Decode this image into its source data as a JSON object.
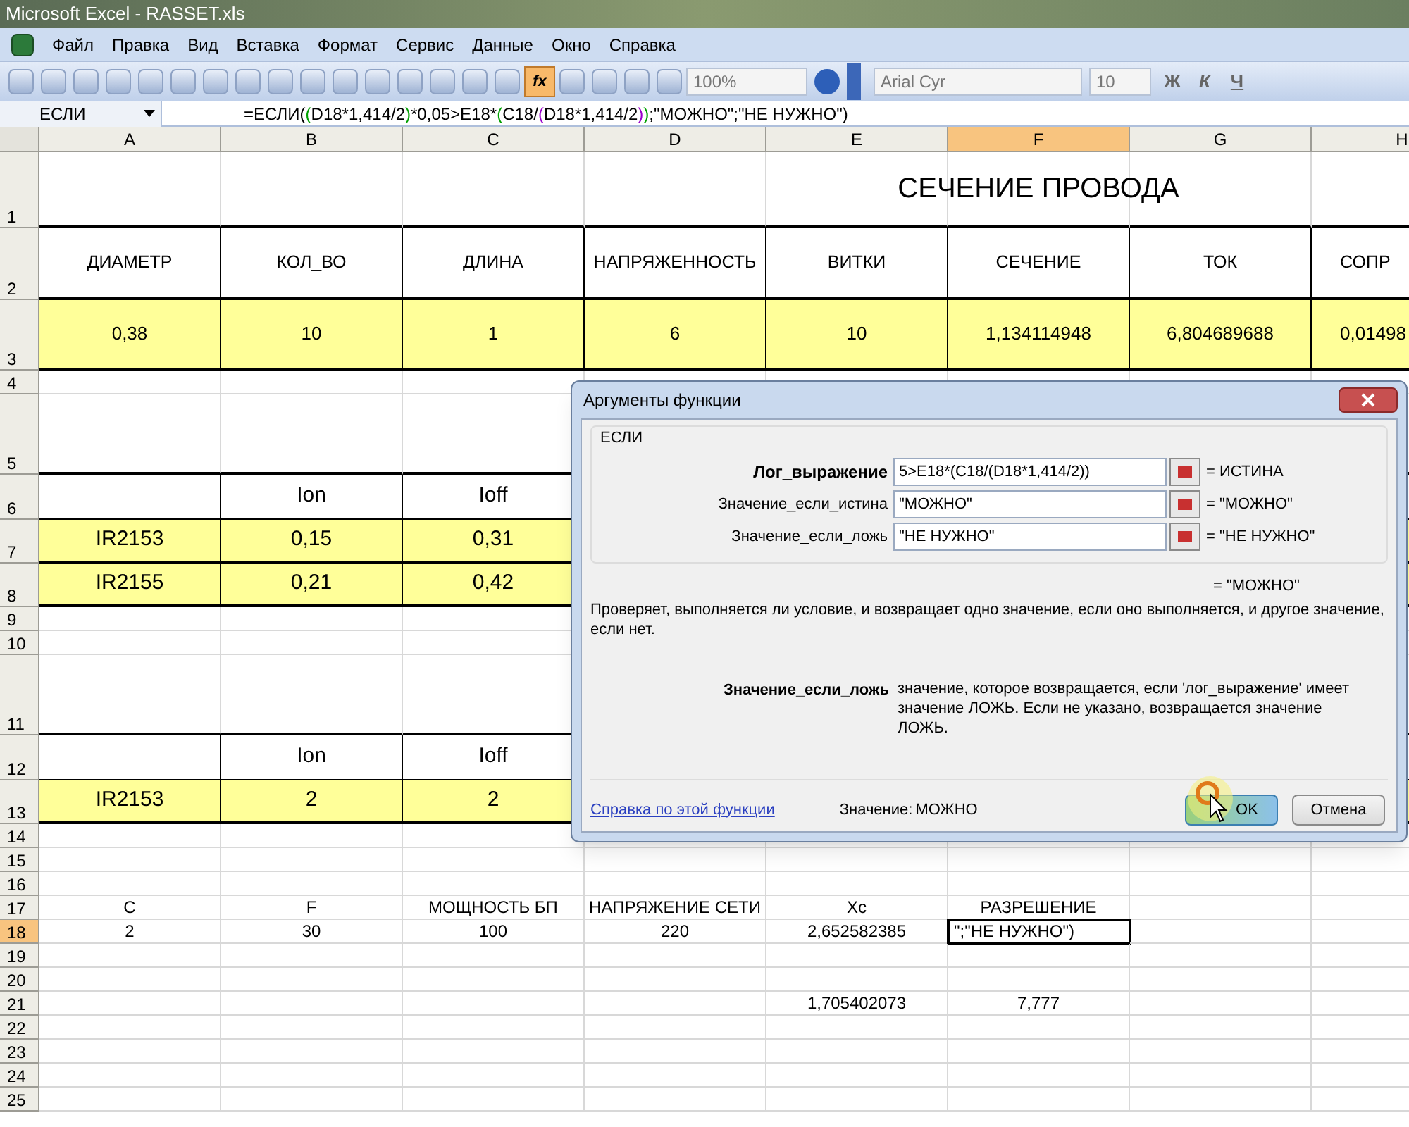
{
  "window": {
    "title": "Microsoft Excel - RASSET.xls"
  },
  "menu": [
    {
      "label": "Файл"
    },
    {
      "label": "Правка"
    },
    {
      "label": "Вид"
    },
    {
      "label": "Вставка"
    },
    {
      "label": "Формат"
    },
    {
      "label": "Сервис"
    },
    {
      "label": "Данные"
    },
    {
      "label": "Окно"
    },
    {
      "label": "Справка"
    }
  ],
  "toolbar": {
    "insert_function_on": true,
    "insert_function_label": "fx",
    "zoom": "100%",
    "font": "Arial Cyr",
    "size": "10",
    "format_buttons": [
      "Ж",
      "К",
      "Ч"
    ]
  },
  "formula_bar": {
    "name_box": "ЕСЛИ",
    "segments": [
      {
        "text": "=ЕСЛИ(",
        "color": "#000000"
      },
      {
        "text": "(",
        "color": "#00a000"
      },
      {
        "text": "D18*1,414/2",
        "color": "#000000"
      },
      {
        "text": ")",
        "color": "#00a000"
      },
      {
        "text": "*0,05>E18*",
        "color": "#000000"
      },
      {
        "text": "(",
        "color": "#00a000"
      },
      {
        "text": "C18/",
        "color": "#000000"
      },
      {
        "text": "(",
        "color": "#9900cc"
      },
      {
        "text": "D18*1,414/2",
        "color": "#000000"
      },
      {
        "text": ")",
        "color": "#9900cc"
      },
      {
        "text": ")",
        "color": "#00a000"
      },
      {
        "text": ";\"МОЖНО\";\"НЕ НУЖНО\")",
        "color": "#000000"
      }
    ]
  },
  "sheet": {
    "columns": [
      {
        "label": "A",
        "selected": false
      },
      {
        "label": "B",
        "selected": false
      },
      {
        "label": "C",
        "selected": false
      },
      {
        "label": "D",
        "selected": false
      },
      {
        "label": "E",
        "selected": false
      },
      {
        "label": "F",
        "selected": true
      },
      {
        "label": "G",
        "selected": false
      },
      {
        "label": "H",
        "selected": false
      }
    ],
    "rows": [
      {
        "label": "1",
        "kind": "title",
        "selected": false,
        "cells": [
          null,
          null,
          null,
          null,
          null,
          "СЕЧЕНИЕ ПРОВОДА"
        ]
      },
      {
        "label": "2",
        "kind": "headbig",
        "selected": false,
        "cells": [
          "ДИАМЕТР",
          "КОЛ_ВО",
          "ДЛИНА",
          "НАПРЯЖЕННОСТЬ",
          "ВИТКИ",
          "СЕЧЕНИЕ",
          "ТОК",
          "СОПР"
        ]
      },
      {
        "label": "3",
        "kind": "databig",
        "selected": false,
        "cells": [
          "0,38",
          "10",
          "1",
          "6",
          "10",
          "1,134114948",
          "6,804689688",
          "0,01498"
        ]
      },
      {
        "label": "4",
        "kind": "plain",
        "selected": false,
        "cells": []
      },
      {
        "label": "5",
        "kind": "spacer",
        "selected": false,
        "cells": [
          null,
          null,
          null
        ]
      },
      {
        "label": "6",
        "kind": "head",
        "selected": false,
        "cells": [
          null,
          "Ion",
          "Ioff"
        ]
      },
      {
        "label": "7",
        "kind": "data",
        "selected": false,
        "cells": [
          "IR2153",
          "0,15",
          "0,31"
        ]
      },
      {
        "label": "8",
        "kind": "data",
        "selected": false,
        "cells": [
          "IR2155",
          "0,21",
          "0,42"
        ]
      },
      {
        "label": "9",
        "kind": "plain",
        "selected": false,
        "cells": []
      },
      {
        "label": "10",
        "kind": "plain",
        "selected": false,
        "cells": []
      },
      {
        "label": "11",
        "kind": "spacer",
        "selected": false,
        "cells": [
          null,
          null,
          null
        ]
      },
      {
        "label": "12",
        "kind": "head",
        "selected": false,
        "cells": [
          null,
          "Ion",
          "Ioff"
        ]
      },
      {
        "label": "13",
        "kind": "data",
        "selected": false,
        "cells": [
          "IR2153",
          "2",
          "2"
        ]
      },
      {
        "label": "14",
        "kind": "plain",
        "selected": false,
        "cells": []
      },
      {
        "label": "15",
        "kind": "plain",
        "selected": false,
        "cells": []
      },
      {
        "label": "16",
        "kind": "plain",
        "selected": false,
        "cells": []
      },
      {
        "label": "17",
        "kind": "plain",
        "selected": false,
        "cells": [
          "C",
          "F",
          "МОЩНОСТЬ БП",
          "НАПРЯЖЕНИЕ СЕТИ",
          "Xc",
          "РАЗРЕШЕНИЕ"
        ]
      },
      {
        "label": "18",
        "kind": "plain",
        "selected": true,
        "cells": [
          "2",
          "30",
          "100",
          "220",
          "2,652582385",
          "\";\"НЕ НУЖНО\")"
        ]
      },
      {
        "label": "19",
        "kind": "plain",
        "selected": false,
        "cells": []
      },
      {
        "label": "20",
        "kind": "plain",
        "selected": false,
        "cells": []
      },
      {
        "label": "21",
        "kind": "plain",
        "selected": false,
        "cells": [
          null,
          null,
          null,
          null,
          "1,705402073",
          "7,777"
        ]
      },
      {
        "label": "22",
        "kind": "plain",
        "selected": false,
        "cells": []
      },
      {
        "label": "23",
        "kind": "plain",
        "selected": false,
        "cells": []
      },
      {
        "label": "24",
        "kind": "plain",
        "selected": false,
        "cells": []
      },
      {
        "label": "25",
        "kind": "plain",
        "selected": false,
        "cells": []
      }
    ]
  },
  "dialog": {
    "title": "Аргументы функции",
    "function": "ЕСЛИ",
    "arguments": [
      {
        "label": "Лог_выражение",
        "value": "5>E18*(C18/(D18*1,414/2))",
        "result": "= ИСТИНА",
        "selected": true
      },
      {
        "label": "Значение_если_истина",
        "value": "\"МОЖНО\"",
        "result": "= \"МОЖНО\"",
        "selected": false
      },
      {
        "label": "Значение_если_ложь",
        "value": "\"НЕ НУЖНО\"",
        "result": "= \"НЕ НУЖНО\"",
        "selected": false
      }
    ],
    "formula_result": "= \"МОЖНО\"",
    "description": "Проверяет, выполняется ли условие, и возвращает одно значение, если оно выполняется, и другое значение, если нет.",
    "argument_name": "Значение_если_ложь",
    "argument_help": "значение, которое возвращается, если 'лог_выражение' имеет значение ЛОЖЬ. Если не указано, возвращается значение ЛОЖЬ.",
    "help_link": "Справка по этой функции",
    "value_label": "Значение:",
    "value": "МОЖНО",
    "buttons": [
      {
        "label": "OK",
        "selected": true
      },
      {
        "label": "Отмена",
        "selected": false
      }
    ]
  }
}
